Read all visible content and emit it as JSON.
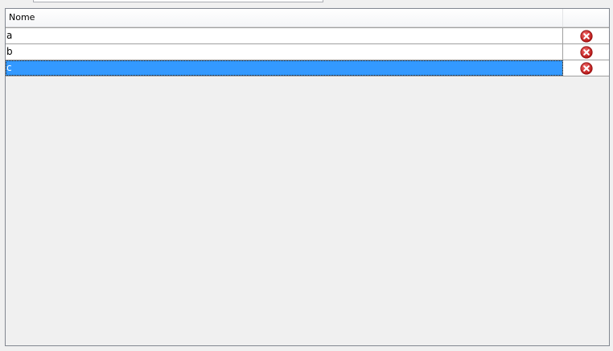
{
  "top_input": {
    "value": ""
  },
  "table": {
    "columns": [
      {
        "label": "Nome"
      },
      {
        "label": ""
      }
    ],
    "rows": [
      {
        "name": "a",
        "action_icon": "delete-icon",
        "selected": false
      },
      {
        "name": "b",
        "action_icon": "delete-icon",
        "selected": false
      },
      {
        "name": "c",
        "action_icon": "delete-icon",
        "selected": true
      }
    ]
  },
  "colors": {
    "selection": "#3399ff",
    "delete_icon": "#d21f1f",
    "background": "#f0f0f0"
  }
}
